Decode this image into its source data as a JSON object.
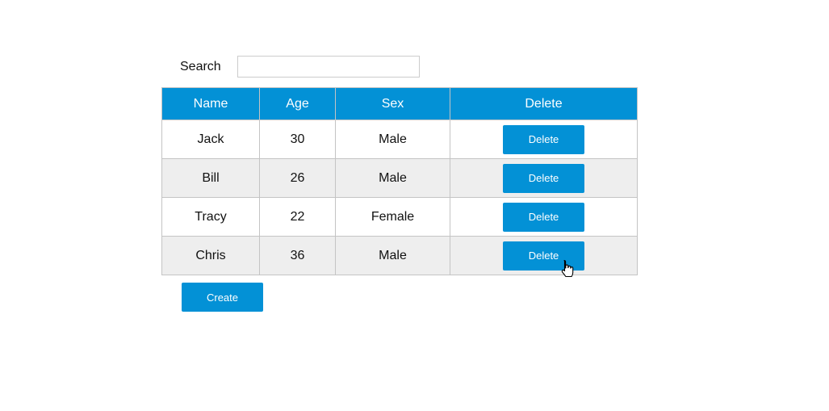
{
  "search": {
    "label": "Search",
    "value": "",
    "placeholder": ""
  },
  "table": {
    "headers": [
      "Name",
      "Age",
      "Sex",
      "Delete"
    ],
    "rows": [
      {
        "name": "Jack",
        "age": "30",
        "sex": "Male",
        "action": "Delete"
      },
      {
        "name": "Bill",
        "age": "26",
        "sex": "Male",
        "action": "Delete"
      },
      {
        "name": "Tracy",
        "age": "22",
        "sex": "Female",
        "action": "Delete"
      },
      {
        "name": "Chris",
        "age": "36",
        "sex": "Male",
        "action": "Delete"
      }
    ]
  },
  "create_label": "Create",
  "colors": {
    "accent": "#0391d6",
    "alt_row": "#eeeeee"
  }
}
